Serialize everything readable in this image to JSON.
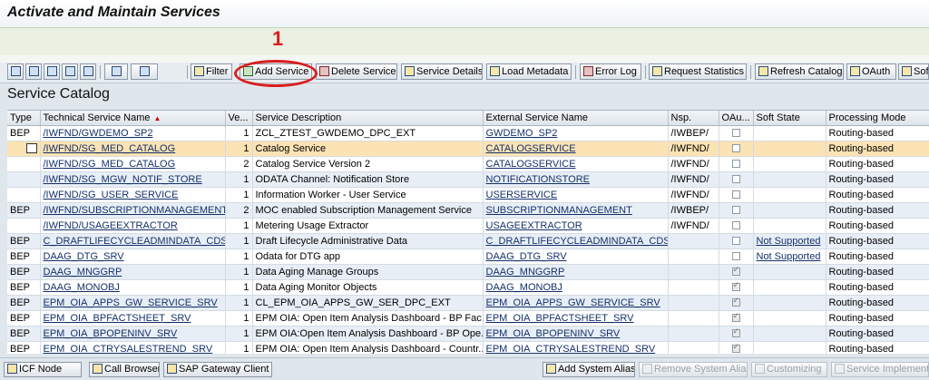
{
  "window": {
    "title": "Activate and Maintain Services"
  },
  "toolbar": {
    "filter": "Filter",
    "add_service": "Add Service",
    "delete_service": "Delete Service",
    "service_details": "Service Details",
    "load_metadata": "Load Metadata",
    "error_log": "Error Log",
    "request_statistics": "Request Statistics",
    "refresh_catalog": "Refresh Catalog",
    "oauth": "OAuth",
    "soft": "Soft"
  },
  "annotation": {
    "number": "1",
    "color": "#d91e1e"
  },
  "catalog": {
    "title": "Service Catalog",
    "columns": [
      "Type",
      "Technical Service Name",
      "Ve...",
      "Service Description",
      "External Service Name",
      "Nsp.",
      "OAu...",
      "Soft State",
      "Processing Mode"
    ],
    "rows": [
      {
        "type": "BEP",
        "tech": "/IWFND/GWDEMO_SP2",
        "ver": "1",
        "desc": "ZCL_ZTEST_GWDEMO_DPC_EXT",
        "ext": "GWDEMO_SP2",
        "nsp": "/IWBEP/",
        "oauth": false,
        "soft": "",
        "mode": "Routing-based"
      },
      {
        "type": "",
        "tech": "/IWFND/SG_MED_CATALOG",
        "ver": "1",
        "desc": "Catalog Service",
        "ext": "CATALOGSERVICE",
        "nsp": "/IWFND/",
        "oauth": false,
        "soft": "",
        "mode": "Routing-based"
      },
      {
        "type": "",
        "tech": "/IWFND/SG_MED_CATALOG",
        "ver": "2",
        "desc": "Catalog Service Version 2",
        "ext": "CATALOGSERVICE",
        "nsp": "/IWFND/",
        "oauth": false,
        "soft": "",
        "mode": "Routing-based"
      },
      {
        "type": "",
        "tech": "/IWFND/SG_MGW_NOTIF_STORE",
        "ver": "1",
        "desc": "ODATA Channel: Notification Store",
        "ext": "NOTIFICATIONSTORE",
        "nsp": "/IWFND/",
        "oauth": false,
        "soft": "",
        "mode": "Routing-based"
      },
      {
        "type": "",
        "tech": "/IWFND/SG_USER_SERVICE",
        "ver": "1",
        "desc": "Information Worker - User Service",
        "ext": "USERSERVICE",
        "nsp": "/IWFND/",
        "oauth": false,
        "soft": "",
        "mode": "Routing-based"
      },
      {
        "type": "BEP",
        "tech": "/IWFND/SUBSCRIPTIONMANAGEMENT",
        "ver": "2",
        "desc": "MOC enabled Subscription Management Service",
        "ext": "SUBSCRIPTIONMANAGEMENT",
        "nsp": "/IWBEP/",
        "oauth": false,
        "soft": "",
        "mode": "Routing-based"
      },
      {
        "type": "",
        "tech": "/IWFND/USAGEEXTRACTOR",
        "ver": "1",
        "desc": "Metering Usage Extractor",
        "ext": "USAGEEXTRACTOR",
        "nsp": "/IWFND/",
        "oauth": false,
        "soft": "",
        "mode": "Routing-based"
      },
      {
        "type": "BEP",
        "tech": "C_DRAFTLIFECYCLEADMINDATA_CDS",
        "ver": "1",
        "desc": "Draft Lifecycle Administrative Data",
        "ext": "C_DRAFTLIFECYCLEADMINDATA_CDS",
        "nsp": "",
        "oauth": false,
        "soft": "Not Supported",
        "mode": "Routing-based"
      },
      {
        "type": "BEP",
        "tech": "DAAG_DTG_SRV",
        "ver": "1",
        "desc": "Odata for DTG app",
        "ext": "DAAG_DTG_SRV",
        "nsp": "",
        "oauth": false,
        "soft": "Not Supported",
        "mode": "Routing-based"
      },
      {
        "type": "BEP",
        "tech": "DAAG_MNGGRP",
        "ver": "1",
        "desc": "Data Aging Manage Groups",
        "ext": "DAAG_MNGGRP",
        "nsp": "",
        "oauth": true,
        "soft": "",
        "mode": "Routing-based"
      },
      {
        "type": "BEP",
        "tech": "DAAG_MONOBJ",
        "ver": "1",
        "desc": "Data Aging Monitor Objects",
        "ext": "DAAG_MONOBJ",
        "nsp": "",
        "oauth": true,
        "soft": "",
        "mode": "Routing-based"
      },
      {
        "type": "BEP",
        "tech": "EPM_OIA_APPS_GW_SERVICE_SRV",
        "ver": "1",
        "desc": "CL_EPM_OIA_APPS_GW_SER_DPC_EXT",
        "ext": "EPM_OIA_APPS_GW_SERVICE_SRV",
        "nsp": "",
        "oauth": true,
        "soft": "",
        "mode": "Routing-based"
      },
      {
        "type": "BEP",
        "tech": "EPM_OIA_BPFACTSHEET_SRV",
        "ver": "1",
        "desc": "EPM OIA: Open Item Analysis Dashboard - BP Fac...",
        "ext": "EPM_OIA_BPFACTSHEET_SRV",
        "nsp": "",
        "oauth": true,
        "soft": "",
        "mode": "Routing-based"
      },
      {
        "type": "BEP",
        "tech": "EPM_OIA_BPOPENINV_SRV",
        "ver": "1",
        "desc": "EPM OIA:Open Item Analysis Dashboard - BP Ope...",
        "ext": "EPM_OIA_BPOPENINV_SRV",
        "nsp": "",
        "oauth": true,
        "soft": "",
        "mode": "Routing-based"
      },
      {
        "type": "BEP",
        "tech": "EPM_OIA_CTRYSALESTREND_SRV",
        "ver": "1",
        "desc": "EPM OIA: Open Item Analysis Dashboard - Countr...",
        "ext": "EPM_OIA_CTRYSALESTREND_SRV",
        "nsp": "",
        "oauth": true,
        "soft": "",
        "mode": "Routing-based"
      }
    ]
  },
  "bottom": {
    "icf_node": "ICF Node",
    "call_browser": "Call Browser",
    "sap_gateway_client": "SAP Gateway Client",
    "add_system_alias": "Add System Alias",
    "remove_system_alias": "Remove System Alias",
    "customizing": "Customizing",
    "service_implementation": "Service Implement..."
  }
}
